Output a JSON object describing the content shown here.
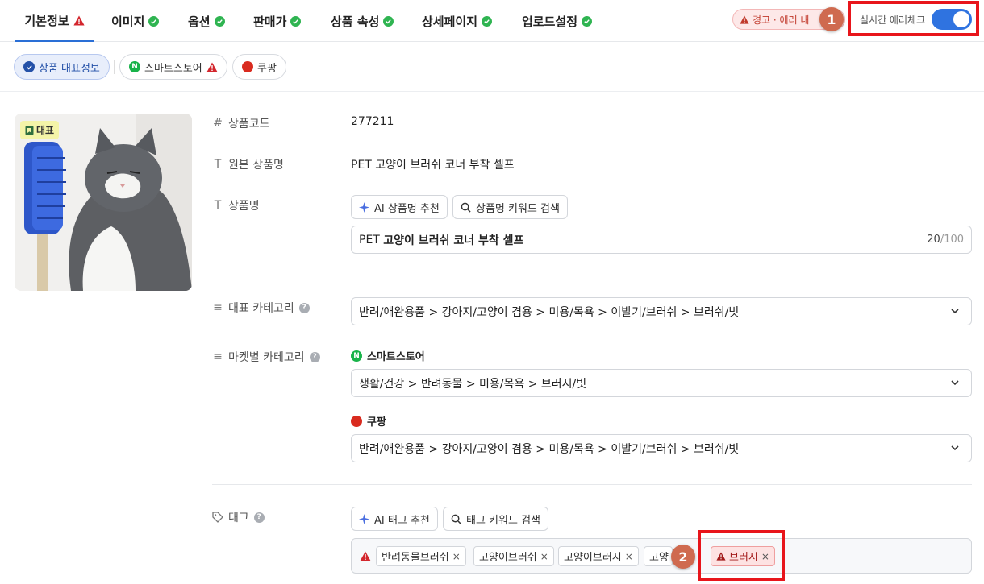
{
  "tabs": [
    {
      "label": "기본정보",
      "status": "warning"
    },
    {
      "label": "이미지",
      "status": "ok"
    },
    {
      "label": "옵션",
      "status": "ok"
    },
    {
      "label": "판매가",
      "status": "ok"
    },
    {
      "label": "상품 속성",
      "status": "ok"
    },
    {
      "label": "상세페이지",
      "status": "ok"
    },
    {
      "label": "업로드설정",
      "status": "ok"
    }
  ],
  "warning_pill": "경고 · 에러 내",
  "realtime_check": {
    "label": "실시간 에러체크",
    "enabled": true
  },
  "annotations": {
    "badge_1": "1",
    "badge_2": "2"
  },
  "subnav": {
    "representative": "상품 대표정보",
    "smartstore": "스마트스토어",
    "coupang": "쿠팡"
  },
  "image": {
    "tag": "대표",
    "icon": "bookmark-icon"
  },
  "fields": {
    "product_code": {
      "label": "상품코드",
      "value": "277211"
    },
    "original_name": {
      "label": "원본 상품명",
      "value": "PET 고양이 브러쉬 코너 부착 셀프"
    },
    "product_name": {
      "label": "상품명",
      "ai_button": "AI 상품명 추천",
      "keyword_button": "상품명 키워드 검색",
      "prefix": "PET ",
      "value_bold": "고양이 브러쉬 코너 부착 셀프",
      "count": "20",
      "max": "/100"
    },
    "main_category": {
      "label": "대표 카테고리",
      "value": "반려/애완용품 > 강아지/고양이 겸용 > 미용/목욕 > 이발기/브러쉬 > 브러쉬/빗"
    },
    "market_category": {
      "label": "마켓별 카테고리",
      "smartstore_label": "스마트스토어",
      "smartstore_value": "생활/건강 > 반려동물 > 미용/목욕 > 브러시/빗",
      "coupang_label": "쿠팡",
      "coupang_value": "반려/애완용품 > 강아지/고양이 겸용 > 미용/목욕 > 이발기/브러쉬 > 브러쉬/빗"
    },
    "tags": {
      "label": "태그",
      "ai_button": "AI 태그 추천",
      "keyword_button": "태그 키워드 검색",
      "items": [
        "반려동물브러쉬",
        "고양이브러쉬",
        "고양이브러시",
        "고양"
      ],
      "error_item": "브러시"
    }
  },
  "colors": {
    "accent": "#2f73e0",
    "ok": "#2fb451",
    "error": "#d3262d",
    "highlight": "#e8151b"
  }
}
